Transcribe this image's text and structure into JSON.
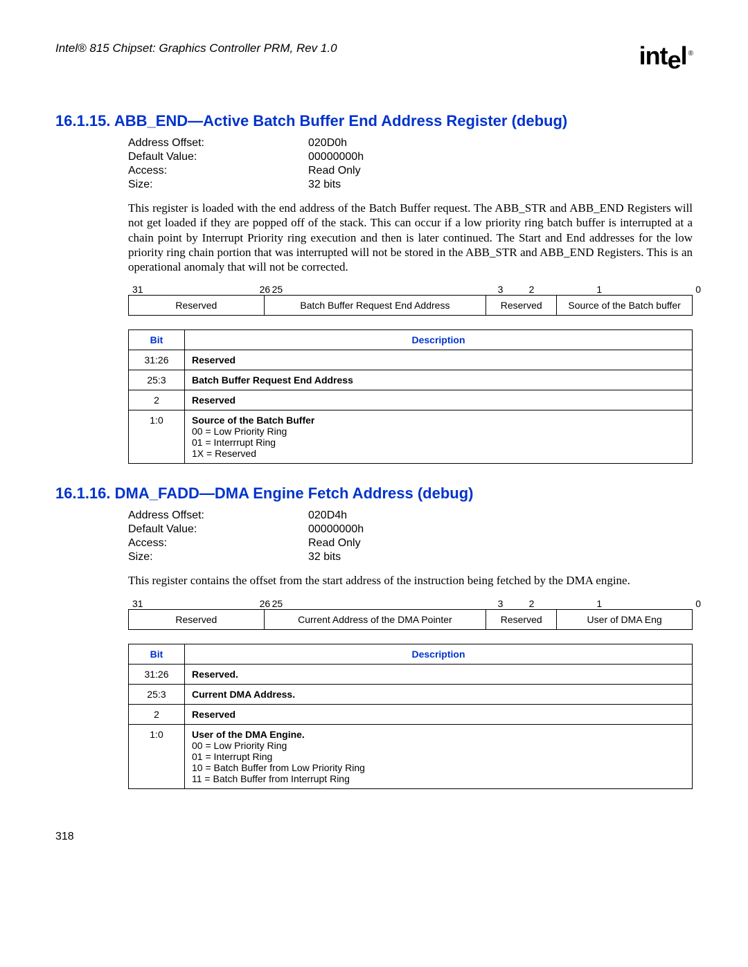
{
  "header": {
    "doc_title": "Intel® 815 Chipset: Graphics Controller PRM, Rev 1.0",
    "logo_text": "intel",
    "logo_tm": "®"
  },
  "section1": {
    "number": "16.1.15.",
    "title": "ABB_END—Active Batch Buffer End Address Register (debug)",
    "meta": {
      "address_offset_label": "Address Offset:",
      "address_offset_value": "020D0h",
      "default_value_label": "Default Value:",
      "default_value_value": "00000000h",
      "access_label": "Access:",
      "access_value": "Read Only",
      "size_label": "Size:",
      "size_value": "32 bits"
    },
    "paragraph": "This register is loaded with the end address of the Batch Buffer request. The ABB_STR and ABB_END Registers will not get loaded if they are popped off of the stack. This can occur if a low priority ring batch buffer is interrupted at a chain point by Interrupt Priority ring execution and then is later continued. The Start and End addresses for the low priority ring chain portion that was interrupted will not be stored in the ABB_STR and ABB_END Registers. This is an operational anomaly that will not be corrected.",
    "bitnums": {
      "n31": "31",
      "n26": "26",
      "n25": "25",
      "n3": "3",
      "n2": "2",
      "n1": "1",
      "n0": "0"
    },
    "bitboxes": {
      "reserved": "Reserved",
      "bbrea": "Batch Buffer Request End Address",
      "reserved2": "Reserved",
      "source": "Source of the Batch buffer"
    },
    "desc_header": {
      "bit": "Bit",
      "description": "Description"
    },
    "rows": [
      {
        "bit": "31:26",
        "title": "Reserved",
        "body": ""
      },
      {
        "bit": "25:3",
        "title": "Batch Buffer Request End Address",
        "body": ""
      },
      {
        "bit": "2",
        "title": "Reserved",
        "body": ""
      },
      {
        "bit": "1:0",
        "title": "Source of the Batch Buffer",
        "body": "00 = Low Priority Ring\n01 = Interrrupt Ring\n1X = Reserved"
      }
    ]
  },
  "section2": {
    "number": "16.1.16.",
    "title": "DMA_FADD—DMA Engine Fetch Address (debug)",
    "meta": {
      "address_offset_label": "Address Offset:",
      "address_offset_value": "020D4h",
      "default_value_label": "Default Value:",
      "default_value_value": "00000000h",
      "access_label": "Access:",
      "access_value": "Read Only",
      "size_label": "Size:",
      "size_value": "32 bits"
    },
    "paragraph": "This register contains the offset from the start address of the instruction being fetched by the DMA engine.",
    "bitnums": {
      "n31": "31",
      "n26": "26",
      "n25": "25",
      "n3": "3",
      "n2": "2",
      "n1": "1",
      "n0": "0"
    },
    "bitboxes": {
      "reserved": "Reserved",
      "curaddr": "Current Address of the DMA Pointer",
      "reserved2": "Reserved",
      "user": "User of DMA Eng"
    },
    "desc_header": {
      "bit": "Bit",
      "description": "Description"
    },
    "rows": [
      {
        "bit": "31:26",
        "title": "Reserved.",
        "body": ""
      },
      {
        "bit": "25:3",
        "title": "Current DMA Address.",
        "body": ""
      },
      {
        "bit": "2",
        "title": "Reserved",
        "body": ""
      },
      {
        "bit": "1:0",
        "title": "User of the DMA Engine.",
        "body": "00 = Low Priority Ring\n01 = Interrupt Ring\n10 = Batch Buffer from Low Priority Ring\n11 = Batch Buffer from Interrupt Ring"
      }
    ]
  },
  "page_number": "318"
}
